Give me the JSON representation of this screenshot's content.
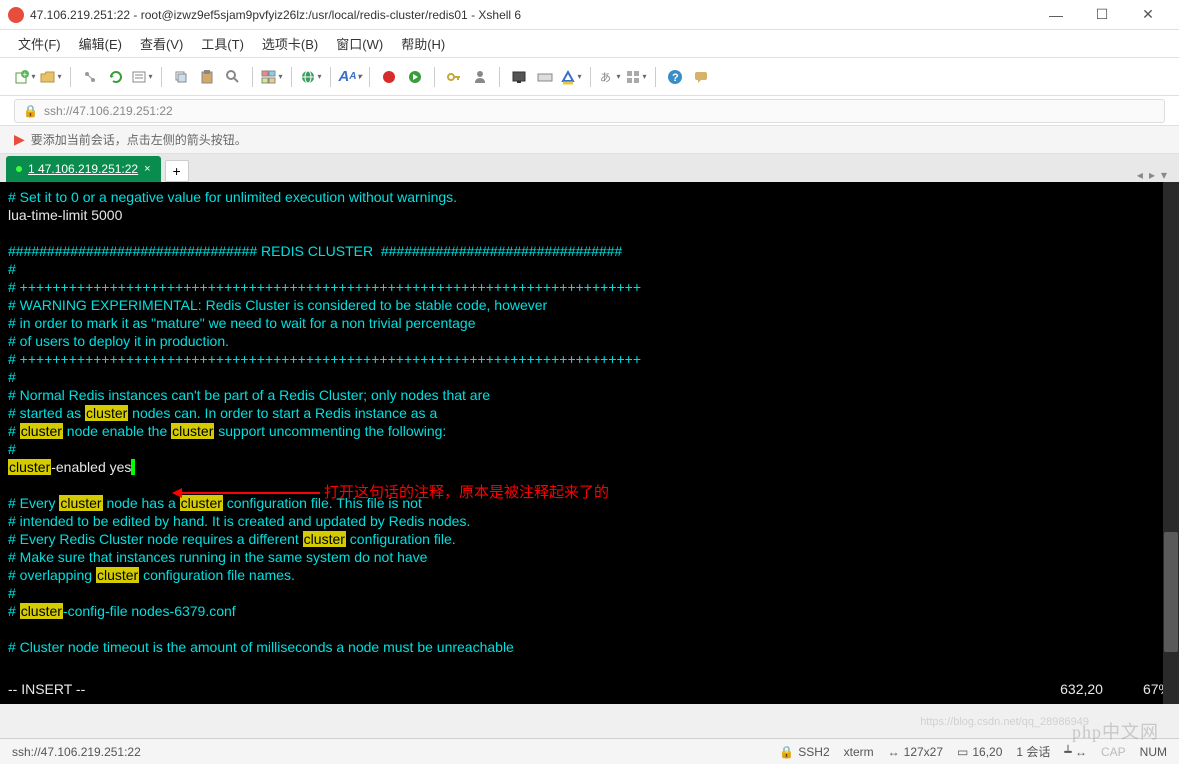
{
  "window": {
    "title": "47.106.219.251:22 - root@izwz9ef5sjam9pvfyiz26lz:/usr/local/redis-cluster/redis01 - Xshell 6",
    "min": "—",
    "max": "☐",
    "close": "✕"
  },
  "menu": {
    "file": "文件(F)",
    "edit": "编辑(E)",
    "view": "查看(V)",
    "tools": "工具(T)",
    "tabs": "选项卡(B)",
    "window": "窗口(W)",
    "help": "帮助(H)"
  },
  "address": {
    "url": "ssh://47.106.219.251:22"
  },
  "infobar": {
    "text": "要添加当前会话，点击左侧的箭头按钮。"
  },
  "tab": {
    "label": "1 47.106.219.251:22",
    "close": "×",
    "add": "+"
  },
  "terminal": {
    "l1": "# Set it to 0 or a negative value for unlimited execution without warnings.",
    "l2": "lua-time-limit 5000",
    "l3": "################################ REDIS CLUSTER  ###############################",
    "l4": "#",
    "l5": "# ++++++++++++++++++++++++++++++++++++++++++++++++++++++++++++++++++++++++++++",
    "l6": "# WARNING EXPERIMENTAL: Redis Cluster is considered to be stable code, however",
    "l7": "# in order to mark it as \"mature\" we need to wait for a non trivial percentage",
    "l8": "# of users to deploy it in production.",
    "l9": "# ++++++++++++++++++++++++++++++++++++++++++++++++++++++++++++++++++++++++++++",
    "l10": "#",
    "l11": "# Normal Redis instances can't be part of a Redis Cluster; only nodes that are",
    "l12a": "# started as ",
    "l12b": " nodes can. In order to start a Redis instance as a",
    "l13a": "# ",
    "l13b": " node enable the ",
    "l13c": " support uncommenting the following:",
    "l14": "#",
    "l15b": "-enabled yes",
    "l17a": "# Every ",
    "l17b": " node has a ",
    "l17c": " configuration file. This file is not",
    "l18": "# intended to be edited by hand. It is created and updated by Redis nodes.",
    "l19a": "# Every Redis Cluster node requires a different ",
    "l19b": " configuration file.",
    "l20": "# Make sure that instances running in the same system do not have",
    "l21a": "# overlapping ",
    "l21b": " configuration file names.",
    "l22": "#",
    "l23a": "# ",
    "l23b": "-config-file nodes-6379.conf",
    "l25": "# Cluster node timeout is the amount of milliseconds a node must be unreachable",
    "hl": "cluster",
    "insert": "-- INSERT --",
    "pos": "632,20",
    "pct": "67%"
  },
  "annotation": {
    "text": "打开这句话的注释，原本是被注释起来了的"
  },
  "statusbar": {
    "left": "ssh://47.106.219.251:22",
    "ssh": "SSH2",
    "term": "xterm",
    "size": "127x27",
    "cursor": "16,20",
    "sessions": "1 会话",
    "cap": "CAP",
    "num": "NUM"
  },
  "watermark": {
    "main": "php中文网",
    "sub": "https://blog.csdn.net/qq_28986949"
  }
}
